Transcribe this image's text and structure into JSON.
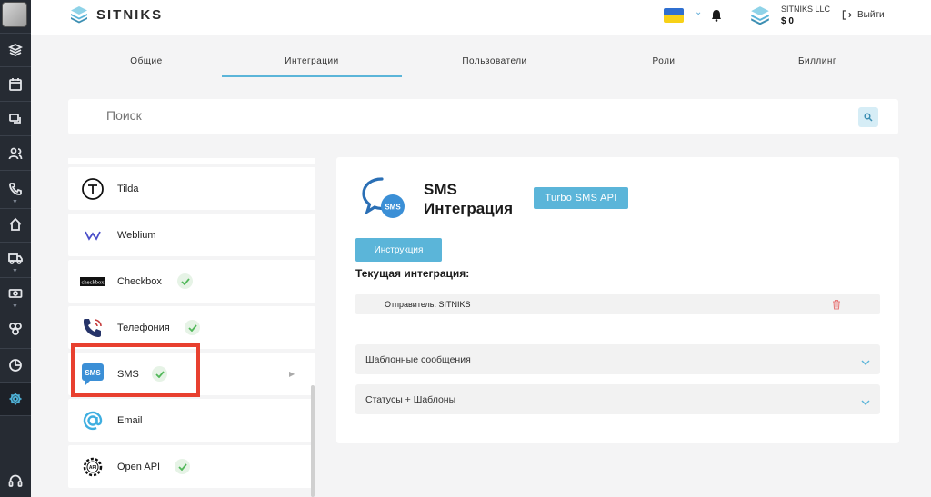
{
  "header": {
    "brand": "SITNIKS",
    "company_name": "SITNIKS LLC",
    "company_balance": "$ 0",
    "logout_label": "Выйти"
  },
  "sidebar": {
    "items": [
      {
        "icon": "layers-icon"
      },
      {
        "icon": "calendar-icon"
      },
      {
        "icon": "chat-icon"
      },
      {
        "icon": "users-icon"
      },
      {
        "icon": "phone-icon"
      },
      {
        "icon": "home-icon"
      },
      {
        "icon": "truck-icon"
      },
      {
        "icon": "cash-icon"
      },
      {
        "icon": "shapes-icon"
      },
      {
        "icon": "pie-chart-icon"
      },
      {
        "icon": "gear-icon"
      },
      {
        "icon": "headset-icon"
      }
    ]
  },
  "tabs": [
    "Общие",
    "Интеграции",
    "Пользователи",
    "Роли",
    "Биллинг"
  ],
  "search": {
    "placeholder": "Поиск"
  },
  "integrations": [
    {
      "label": "Tilda",
      "connected": false
    },
    {
      "label": "Weblium",
      "connected": false
    },
    {
      "label": "Checkbox",
      "connected": true,
      "logo_text": "checkbox"
    },
    {
      "label": "Телефония",
      "connected": true
    },
    {
      "label": "SMS",
      "connected": true,
      "logo_text": "SMS"
    },
    {
      "label": "Email",
      "connected": false
    },
    {
      "label": "Open API",
      "connected": true,
      "logo_text": "API"
    }
  ],
  "detail": {
    "title_line1": "SMS",
    "title_line2": "Интеграция",
    "provider_button": "Turbo SMS API",
    "instruction_button": "Инструкция",
    "current_label": "Текущая интеграция:",
    "sender": "Отправитель: SITNIKS",
    "accordions": [
      "Шаблонные сообщения",
      "Статусы + Шаблоны"
    ]
  },
  "colors": {
    "accent": "#5bb5d9",
    "highlight": "#e8402f",
    "sidebar": "#262b33",
    "check": "#52b85a"
  }
}
